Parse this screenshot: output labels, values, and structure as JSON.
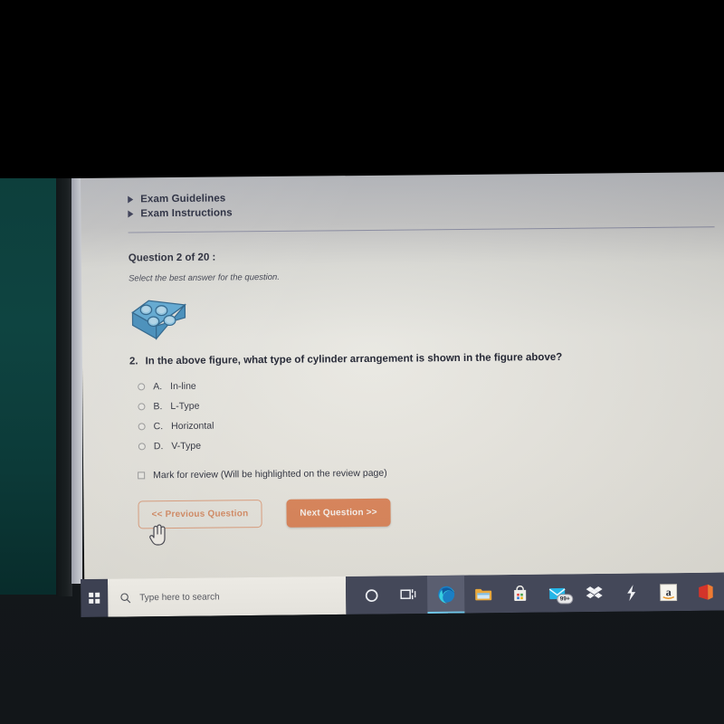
{
  "scene": {
    "description": "Photo of a computer monitor showing an online exam question page",
    "letterbox_top_height_px": 197
  },
  "exam_page": {
    "links": [
      {
        "label": "Exam Guidelines",
        "icon": "triangle-right-icon"
      },
      {
        "label": "Exam Instructions",
        "icon": "triangle-right-icon"
      }
    ],
    "question_header": "Question 2 of 20 :",
    "instruction": "Select the best answer for the question.",
    "figure": {
      "alt": "Blue 3D engine block with four cylinder bores arranged in two rows of two",
      "fill_color": "#5aa9d6",
      "stroke_color": "#2a6f9e",
      "top_face_color": "#7cc3e4",
      "side_face_color": "#3d8cbd",
      "bore_count": 4
    },
    "question_number": "2.",
    "question_text": "In the above figure, what type of cylinder arrangement is shown in the figure above?",
    "options": [
      {
        "letter": "A.",
        "text": "In-line",
        "selected": false
      },
      {
        "letter": "B.",
        "text": "L-Type",
        "selected": false
      },
      {
        "letter": "C.",
        "text": "Horizontal",
        "selected": false
      },
      {
        "letter": "D.",
        "text": "V-Type",
        "selected": false
      }
    ],
    "mark_for_review": {
      "label": "Mark for review (Will be highlighted on the review page)",
      "checked": false
    },
    "buttons": {
      "previous": "<< Previous Question",
      "next": "Next Question >>",
      "next_color": "#dd8559",
      "previous_border_color": "#e0a07e"
    }
  },
  "taskbar": {
    "start_icon": "windows-logo-icon",
    "search_placeholder": "Type here to search",
    "search_icon": "search-icon",
    "items": [
      {
        "name": "cortana-icon",
        "label": "Cortana",
        "active": false,
        "badge": null
      },
      {
        "name": "task-view-icon",
        "label": "Task View",
        "active": false,
        "badge": null
      },
      {
        "name": "microsoft-edge-icon",
        "label": "Microsoft Edge",
        "active": true,
        "badge": null
      },
      {
        "name": "file-explorer-icon",
        "label": "File Explorer",
        "active": false,
        "badge": null
      },
      {
        "name": "microsoft-store-icon",
        "label": "Microsoft Store",
        "active": false,
        "badge": null
      },
      {
        "name": "mail-icon",
        "label": "Mail",
        "active": false,
        "badge": "99+"
      },
      {
        "name": "dropbox-icon",
        "label": "Dropbox",
        "active": false,
        "badge": null
      },
      {
        "name": "lightning-bolt-icon",
        "label": "Lightning",
        "active": false,
        "badge": null
      },
      {
        "name": "amazon-icon",
        "label": "Amazon",
        "active": false,
        "badge": null
      },
      {
        "name": "microsoft-office-icon",
        "label": "Microsoft Office",
        "active": false,
        "badge": null
      }
    ]
  },
  "cursor": {
    "type": "hand-pointer-cursor",
    "over": "previous-question-button"
  }
}
